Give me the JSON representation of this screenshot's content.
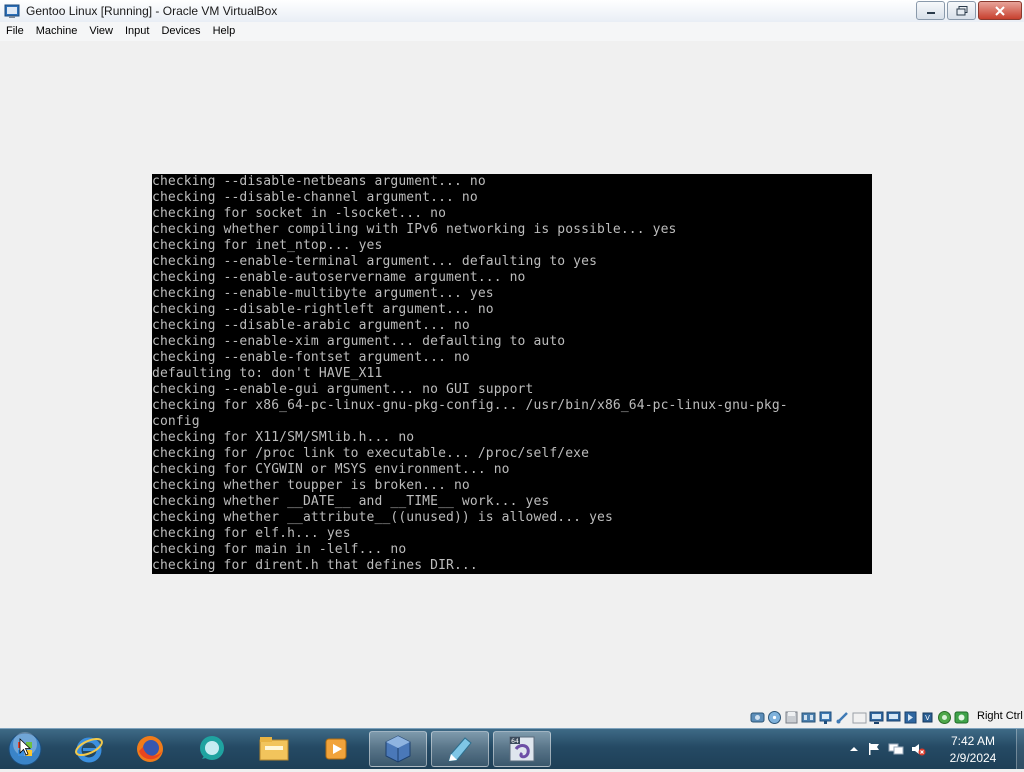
{
  "window": {
    "title": "Gentoo Linux [Running] - Oracle VM VirtualBox"
  },
  "menu": [
    "File",
    "Machine",
    "View",
    "Input",
    "Devices",
    "Help"
  ],
  "console": {
    "lines": [
      "checking --disable-netbeans argument... no",
      "checking --disable-channel argument... no",
      "checking for socket in -lsocket... no",
      "checking whether compiling with IPv6 networking is possible... yes",
      "checking for inet_ntop... yes",
      "checking --enable-terminal argument... defaulting to yes",
      "checking --enable-autoservername argument... no",
      "checking --enable-multibyte argument... yes",
      "checking --disable-rightleft argument... no",
      "checking --disable-arabic argument... no",
      "checking --enable-xim argument... defaulting to auto",
      "checking --enable-fontset argument... no",
      "defaulting to: don't HAVE_X11",
      "checking --enable-gui argument... no GUI support",
      "checking for x86_64-pc-linux-gnu-pkg-config... /usr/bin/x86_64-pc-linux-gnu-pkg-",
      "config",
      "checking for X11/SM/SMlib.h... no",
      "checking for /proc link to executable... /proc/self/exe",
      "checking for CYGWIN or MSYS environment... no",
      "checking whether toupper is broken... no",
      "checking whether __DATE__ and __TIME__ work... yes",
      "checking whether __attribute__((unused)) is allowed... yes",
      "checking for elf.h... yes",
      "checking for main in -lelf... no",
      "checking for dirent.h that defines DIR..."
    ]
  },
  "statusbar": {
    "icons": [
      "hard-disk-icon",
      "optical-drive-icon",
      "floppy-icon",
      "audio-icon",
      "network-icon",
      "usb-icon",
      "shared-folders-icon",
      "display-icon",
      "video-capture-icon",
      "recording-icon",
      "cpu-icon",
      "mouse-integration-icon",
      "keyboard-icon"
    ],
    "host_key": "Right Ctrl"
  },
  "taskbar": {
    "pinned": [
      "internet-explorer-icon",
      "firefox-icon",
      "chat-bubble-icon",
      "file-explorer-icon",
      "media-player-icon",
      "virtualbox-icon",
      "notepad-icon",
      "virtualbox-vm-icon"
    ],
    "clock": {
      "time": "7:42 AM",
      "date": "2/9/2024"
    }
  }
}
